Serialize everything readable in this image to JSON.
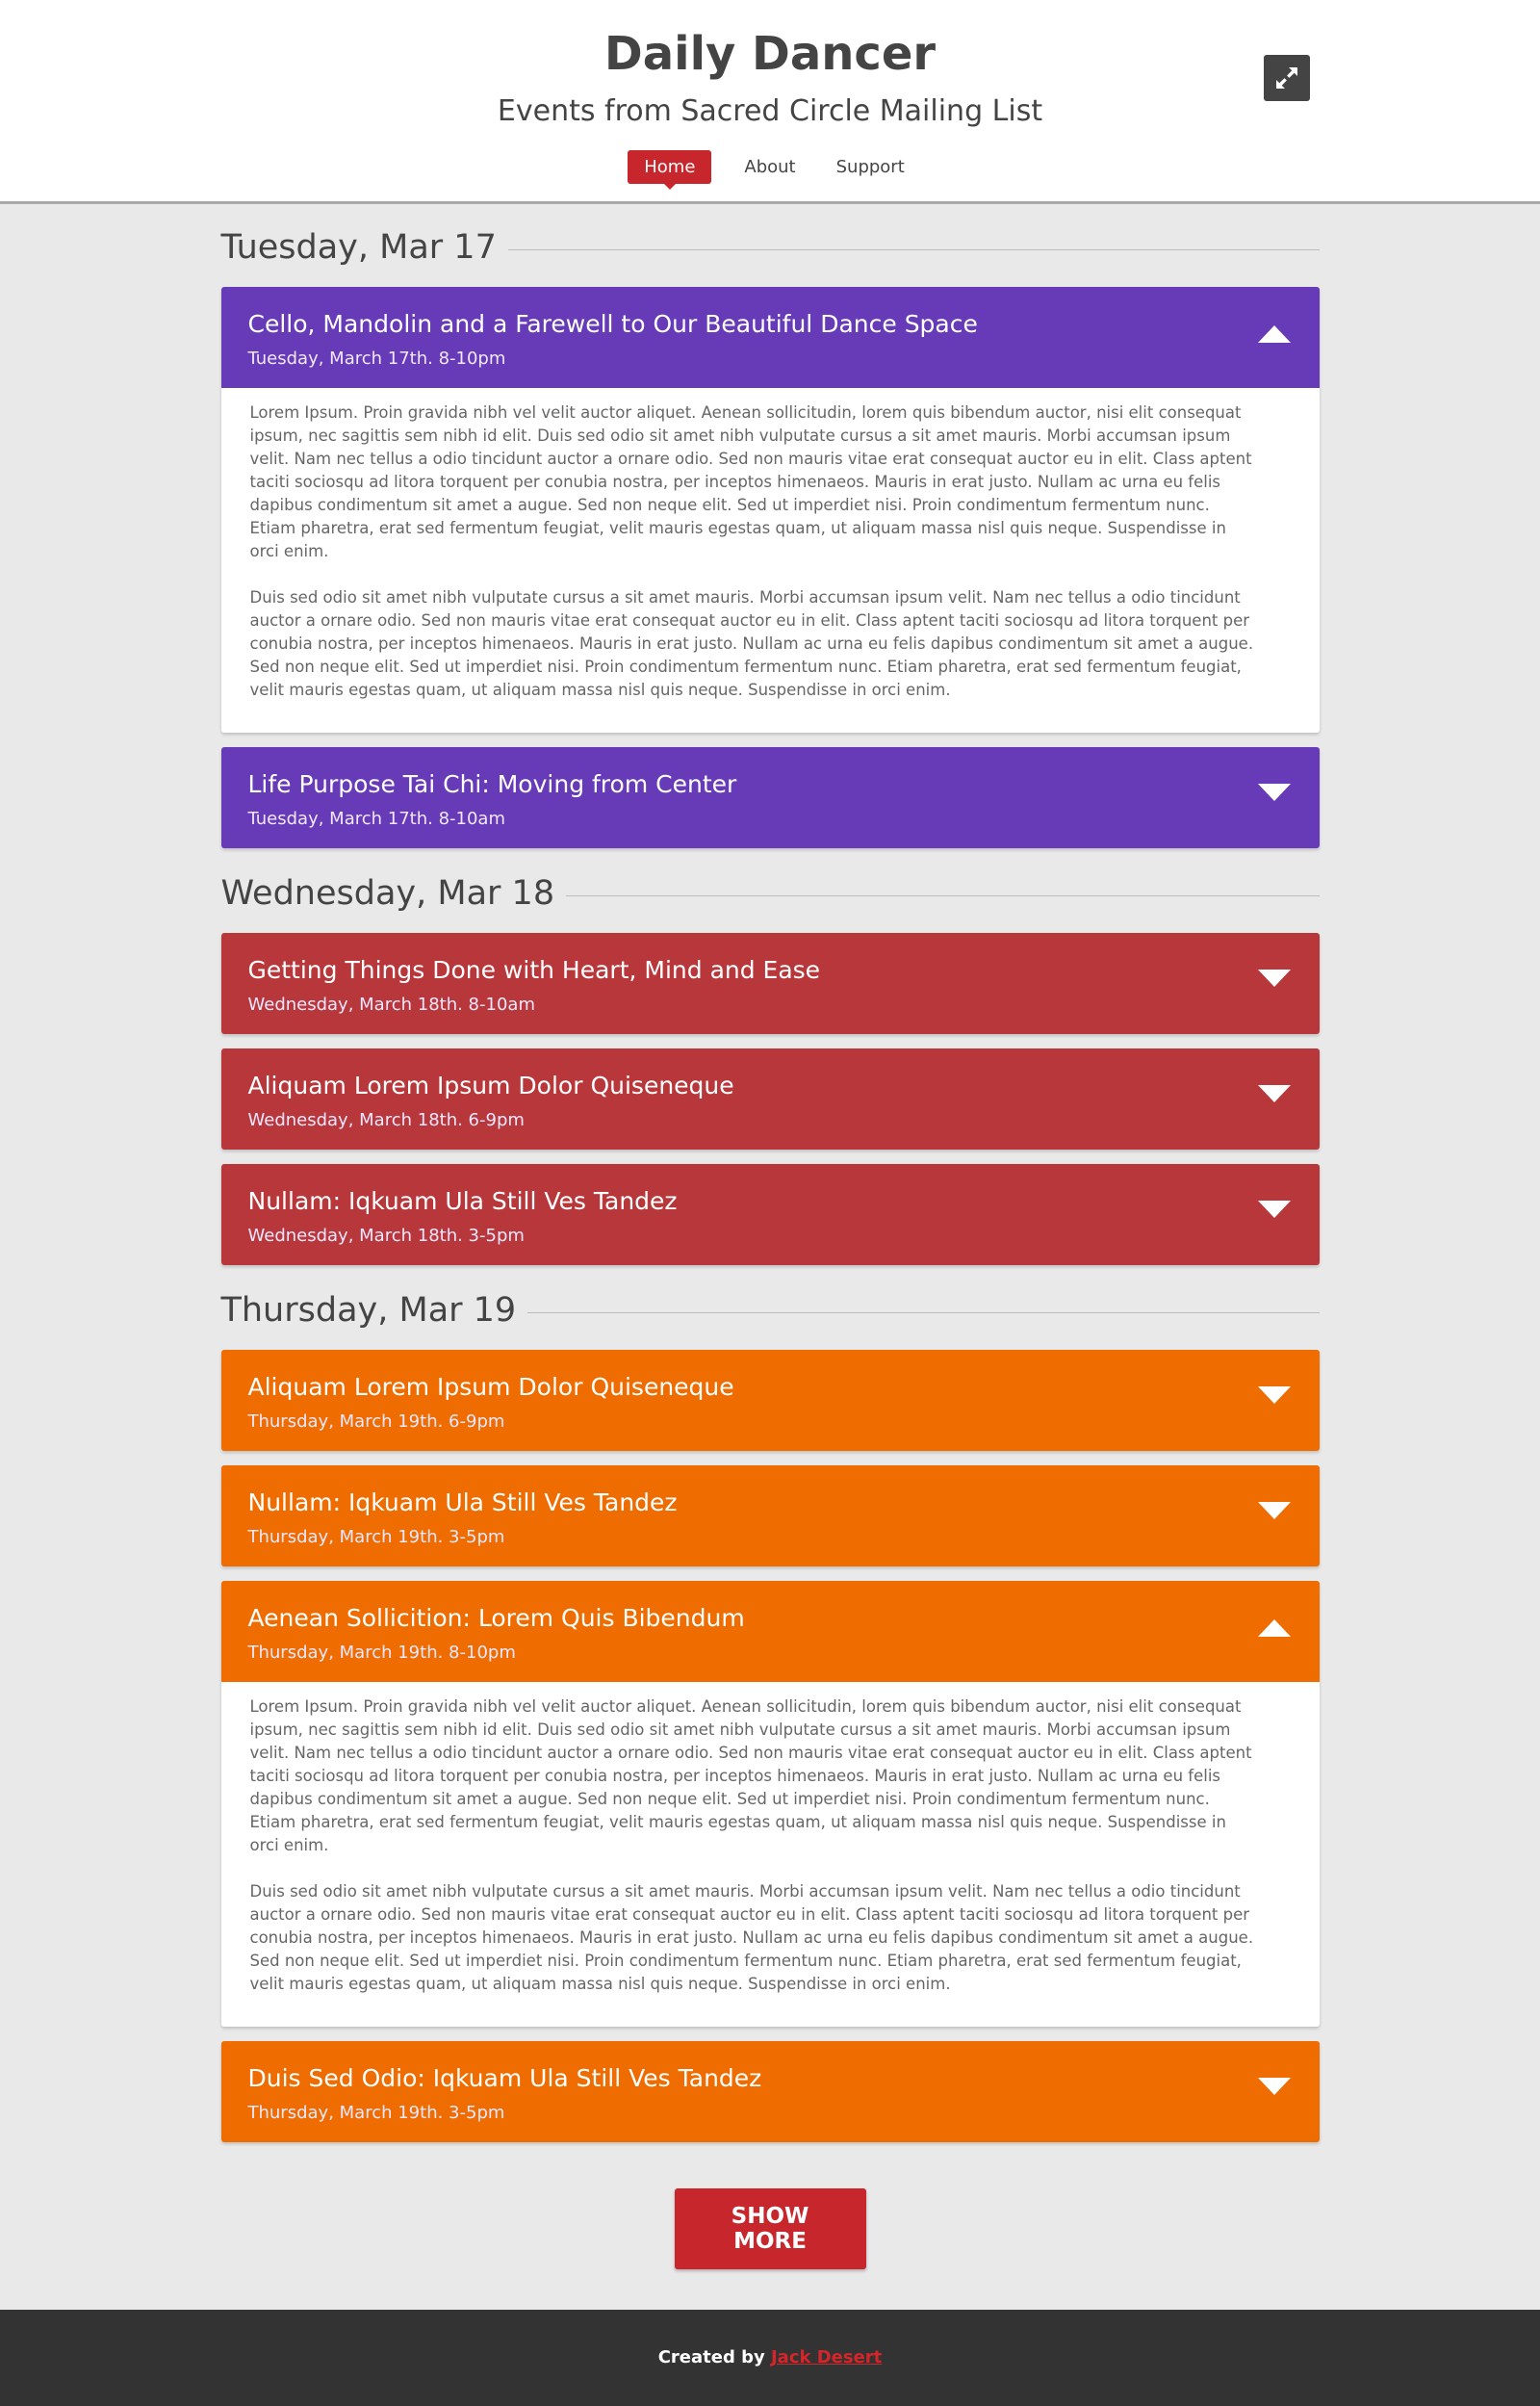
{
  "header": {
    "title": "Daily Dancer",
    "subtitle": "Events from Sacred Circle Mailing List",
    "nav": [
      {
        "label": "Home",
        "active": true
      },
      {
        "label": "About",
        "active": false
      },
      {
        "label": "Support",
        "active": false
      }
    ],
    "expand_icon": "expand-icon"
  },
  "colors": {
    "purple": "#673ab7",
    "red": "#b8373b",
    "orange": "#ef6c00",
    "accent": "#c7272c",
    "footer_bg": "#333333"
  },
  "days": [
    {
      "label": "Tuesday, Mar 17",
      "events": [
        {
          "title": "Cello, Mandolin and a Farewell to Our Beautiful Dance Space",
          "time": "Tuesday, March 17th. 8-10pm",
          "expanded": true,
          "body": [
            "Lorem Ipsum. Proin gravida nibh vel velit auctor aliquet. Aenean sollicitudin, lorem quis bibendum auctor, nisi elit consequat ipsum, nec sagittis sem nibh id elit. Duis sed odio sit amet nibh vulputate cursus a sit amet mauris. Morbi accumsan ipsum velit. Nam nec tellus a odio tincidunt auctor a ornare odio. Sed non  mauris vitae erat consequat auctor eu in elit. Class aptent taciti sociosqu ad litora torquent per conubia nostra, per inceptos himenaeos. Mauris in erat justo. Nullam ac urna eu felis dapibus condimentum sit amet a augue. Sed non neque elit. Sed ut imperdiet nisi. Proin condimentum fermentum nunc. Etiam pharetra, erat sed fermentum feugiat, velit mauris egestas quam, ut aliquam massa nisl quis neque. Suspendisse in orci enim.",
            "Duis sed odio sit amet nibh vulputate cursus a sit amet mauris. Morbi accumsan ipsum velit. Nam nec tellus a odio tincidunt auctor a ornare odio. Sed non  mauris vitae erat consequat auctor eu in elit. Class aptent taciti sociosqu ad litora torquent per conubia nostra, per inceptos himenaeos. Mauris in erat justo. Nullam ac urna eu felis dapibus condimentum sit amet a augue. Sed non neque elit. Sed ut imperdiet nisi. Proin condimentum fermentum nunc. Etiam pharetra, erat sed fermentum feugiat, velit mauris egestas quam, ut aliquam massa nisl quis neque. Suspendisse in orci enim."
          ]
        },
        {
          "title": "Life Purpose Tai Chi: Moving from Center",
          "time": "Tuesday, March 17th. 8-10am",
          "expanded": false
        }
      ]
    },
    {
      "label": "Wednesday, Mar 18",
      "events": [
        {
          "title": "Getting Things Done with Heart, Mind and Ease",
          "time": "Wednesday, March 18th. 8-10am",
          "expanded": false
        },
        {
          "title": "Aliquam Lorem Ipsum Dolor Quiseneque",
          "time": "Wednesday, March 18th. 6-9pm",
          "expanded": false
        },
        {
          "title": "Nullam: Iqkuam Ula Still Ves Tandez",
          "time": "Wednesday, March 18th. 3-5pm",
          "expanded": false
        }
      ]
    },
    {
      "label": "Thursday, Mar 19",
      "events": [
        {
          "title": "Aliquam Lorem Ipsum Dolor Quiseneque",
          "time": "Thursday, March 19th. 6-9pm",
          "expanded": false
        },
        {
          "title": "Nullam: Iqkuam Ula Still Ves Tandez",
          "time": "Thursday, March 19th. 3-5pm",
          "expanded": false
        },
        {
          "title": "Aenean Sollicition: Lorem Quis Bibendum",
          "time": "Thursday, March 19th. 8-10pm",
          "expanded": true,
          "body": [
            "Lorem Ipsum. Proin gravida nibh vel velit auctor aliquet. Aenean sollicitudin, lorem quis bibendum auctor, nisi elit consequat ipsum, nec sagittis sem nibh id elit. Duis sed odio sit amet nibh vulputate cursus a sit amet mauris. Morbi accumsan ipsum velit. Nam nec tellus a odio tincidunt auctor a ornare odio. Sed non  mauris vitae erat consequat auctor eu in elit. Class aptent taciti sociosqu ad litora torquent per conubia nostra, per inceptos himenaeos. Mauris in erat justo. Nullam ac urna eu felis dapibus condimentum sit amet a augue. Sed non neque elit. Sed ut imperdiet nisi. Proin condimentum fermentum nunc. Etiam pharetra, erat sed fermentum feugiat, velit mauris egestas quam, ut aliquam massa nisl quis neque. Suspendisse in orci enim.",
            "Duis sed odio sit amet nibh vulputate cursus a sit amet mauris. Morbi accumsan ipsum velit. Nam nec tellus a odio tincidunt auctor a ornare odio. Sed non  mauris vitae erat consequat auctor eu in elit. Class aptent taciti sociosqu ad litora torquent per conubia nostra, per inceptos himenaeos. Mauris in erat justo. Nullam ac urna eu felis dapibus condimentum sit amet a augue. Sed non neque elit. Sed ut imperdiet nisi. Proin condimentum fermentum nunc. Etiam pharetra, erat sed fermentum feugiat, velit mauris egestas quam, ut aliquam massa nisl quis neque. Suspendisse in orci enim."
          ]
        },
        {
          "title": "Duis Sed Odio: Iqkuam Ula Still Ves Tandez",
          "time": "Thursday, March 19th. 3-5pm",
          "expanded": false
        }
      ]
    }
  ],
  "show_more_label": "SHOW MORE",
  "footer": {
    "prefix": "Created by",
    "author": "Jack Desert"
  }
}
